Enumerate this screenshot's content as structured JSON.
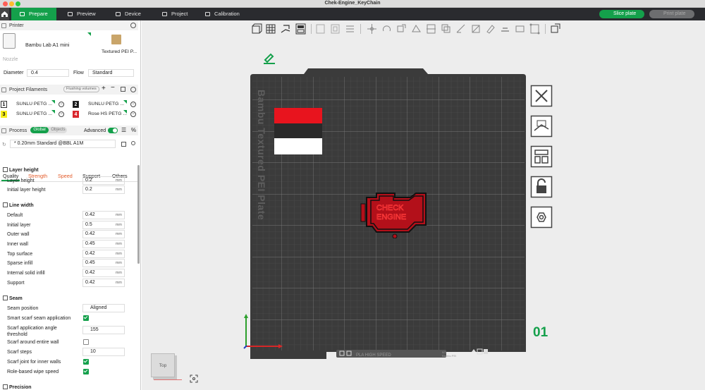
{
  "window": {
    "title": "Chek-Engine_KeyChain",
    "dot_colors": [
      "#ff5f57",
      "#febc2e",
      "#28c840"
    ]
  },
  "topbar": {
    "tabs": [
      {
        "label": "Prepare",
        "active": true
      },
      {
        "label": "Preview"
      },
      {
        "label": "Device"
      },
      {
        "label": "Project"
      },
      {
        "label": "Calibration"
      }
    ],
    "slice_label": "Slice plate",
    "print_label": "Print plate",
    "accent": "#14a04b"
  },
  "printer": {
    "header": "Printer",
    "name": "Bambu Lab A1 mini",
    "plate": "Textured PEI P...",
    "nozzle_label": "Nozzle",
    "diameter_label": "Diameter",
    "diameter_value": "0.4",
    "flow_label": "Flow",
    "flow_value": "Standard"
  },
  "filaments": {
    "header": "Project Filaments",
    "flush_label": "Flushing volumes",
    "items": [
      {
        "num": "1",
        "name": "SUNLU PETG ...",
        "color": "#ffffff",
        "text": "#000"
      },
      {
        "num": "2",
        "name": "SUNLU PETG ...",
        "color": "#111111",
        "text": "#fff"
      },
      {
        "num": "3",
        "name": "SUNLU PETG ...",
        "color": "#f5ed1a",
        "text": "#000"
      },
      {
        "num": "4",
        "name": "Rose HS PETG ...",
        "color": "#d9262c",
        "text": "#fff"
      }
    ]
  },
  "process": {
    "header": "Process",
    "toggle_global": "Global",
    "toggle_objects": "Objects",
    "advanced_label": "Advanced",
    "preset": "* 0.20mm Standard @BBL A1M",
    "tabs": [
      "Quality",
      "Strength",
      "Speed",
      "Support",
      "Others"
    ]
  },
  "params": {
    "layer_height": {
      "title": "Layer height",
      "rows": [
        {
          "label": "Layer height",
          "value": "0.2",
          "unit": "mm"
        },
        {
          "label": "Initial layer height",
          "value": "0.2",
          "unit": "mm"
        }
      ]
    },
    "line_width": {
      "title": "Line width",
      "rows": [
        {
          "label": "Default",
          "value": "0.42",
          "unit": "mm"
        },
        {
          "label": "Initial layer",
          "value": "0.5",
          "unit": "mm"
        },
        {
          "label": "Outer wall",
          "value": "0.42",
          "unit": "mm"
        },
        {
          "label": "Inner wall",
          "value": "0.45",
          "unit": "mm"
        },
        {
          "label": "Top surface",
          "value": "0.42",
          "unit": "mm"
        },
        {
          "label": "Sparse infill",
          "value": "0.45",
          "unit": "mm"
        },
        {
          "label": "Internal solid infill",
          "value": "0.42",
          "unit": "mm"
        },
        {
          "label": "Support",
          "value": "0.42",
          "unit": "mm"
        }
      ]
    },
    "seam": {
      "title": "Seam",
      "position_label": "Seam position",
      "position_value": "Aligned",
      "smart_label": "Smart scarf seam application",
      "threshold_label": "Scarf application angle threshold",
      "threshold_value": "155",
      "around_label": "Scarf around entire wall",
      "steps_label": "Scarf steps",
      "steps_value": "10",
      "inner_label": "Scarf joint for inner walls",
      "wipe_label": "Role-based wipe speed"
    },
    "precision_title": "Precision"
  },
  "viewport": {
    "plate_text": "Bambu Textured PEI Plate",
    "plate_number": "01",
    "keychain_text_1": "CHECK",
    "keychain_text_2": "ENGINE",
    "view_cube_label": "Top",
    "plate_filament_label": "PLA HIGH SPEED",
    "plate_info_1": "0/1",
    "plate_info_2": "Bambu PEI",
    "plate_color": "#3b3b3b",
    "keychain_color": "#e8141e"
  }
}
